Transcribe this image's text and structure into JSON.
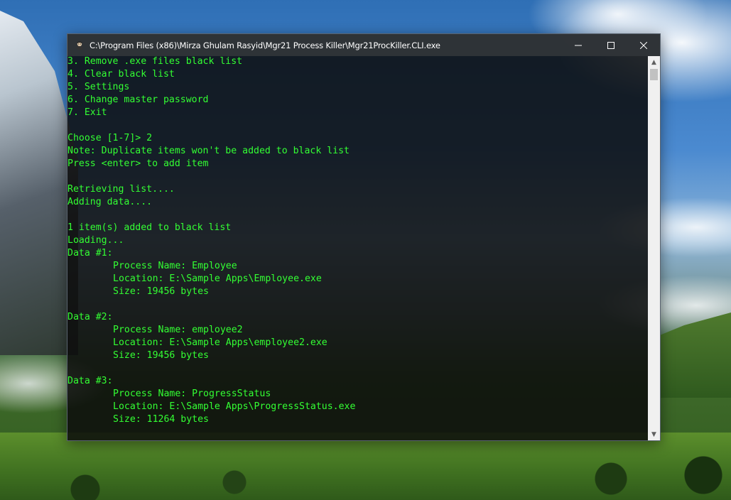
{
  "window": {
    "title": "C:\\Program Files (x86)\\Mirza Ghulam Rasyid\\Mgr21 Process Killer\\Mgr21ProcKiller.CLI.exe",
    "icon": "app-icon",
    "controls": {
      "minimize": "—",
      "maximize": "☐",
      "close": "✕"
    }
  },
  "console": {
    "lines": [
      "3. Remove .exe files black list",
      "4. Clear black list",
      "5. Settings",
      "6. Change master password",
      "7. Exit",
      "",
      "Choose [1-7]> 2",
      "Note: Duplicate items won't be added to black list",
      "Press <enter> to add item",
      "",
      "Retrieving list....",
      "Adding data....",
      "",
      "1 item(s) added to black list",
      "Loading...",
      "Data #1:",
      "Process Name: Employee",
      "Location: E:\\Sample Apps\\Employee.exe",
      "Size: 19456 bytes",
      "",
      "Data #2:",
      "Process Name: employee2",
      "Location: E:\\Sample Apps\\employee2.exe",
      "Size: 19456 bytes",
      "",
      "Data #3:",
      "Process Name: ProgressStatus",
      "Location: E:\\Sample Apps\\ProgressStatus.exe",
      "Size: 11264 bytes"
    ],
    "text_color": "#33ff33"
  },
  "scrollbar": {
    "up_arrow": "▲",
    "down_arrow": "▼"
  }
}
